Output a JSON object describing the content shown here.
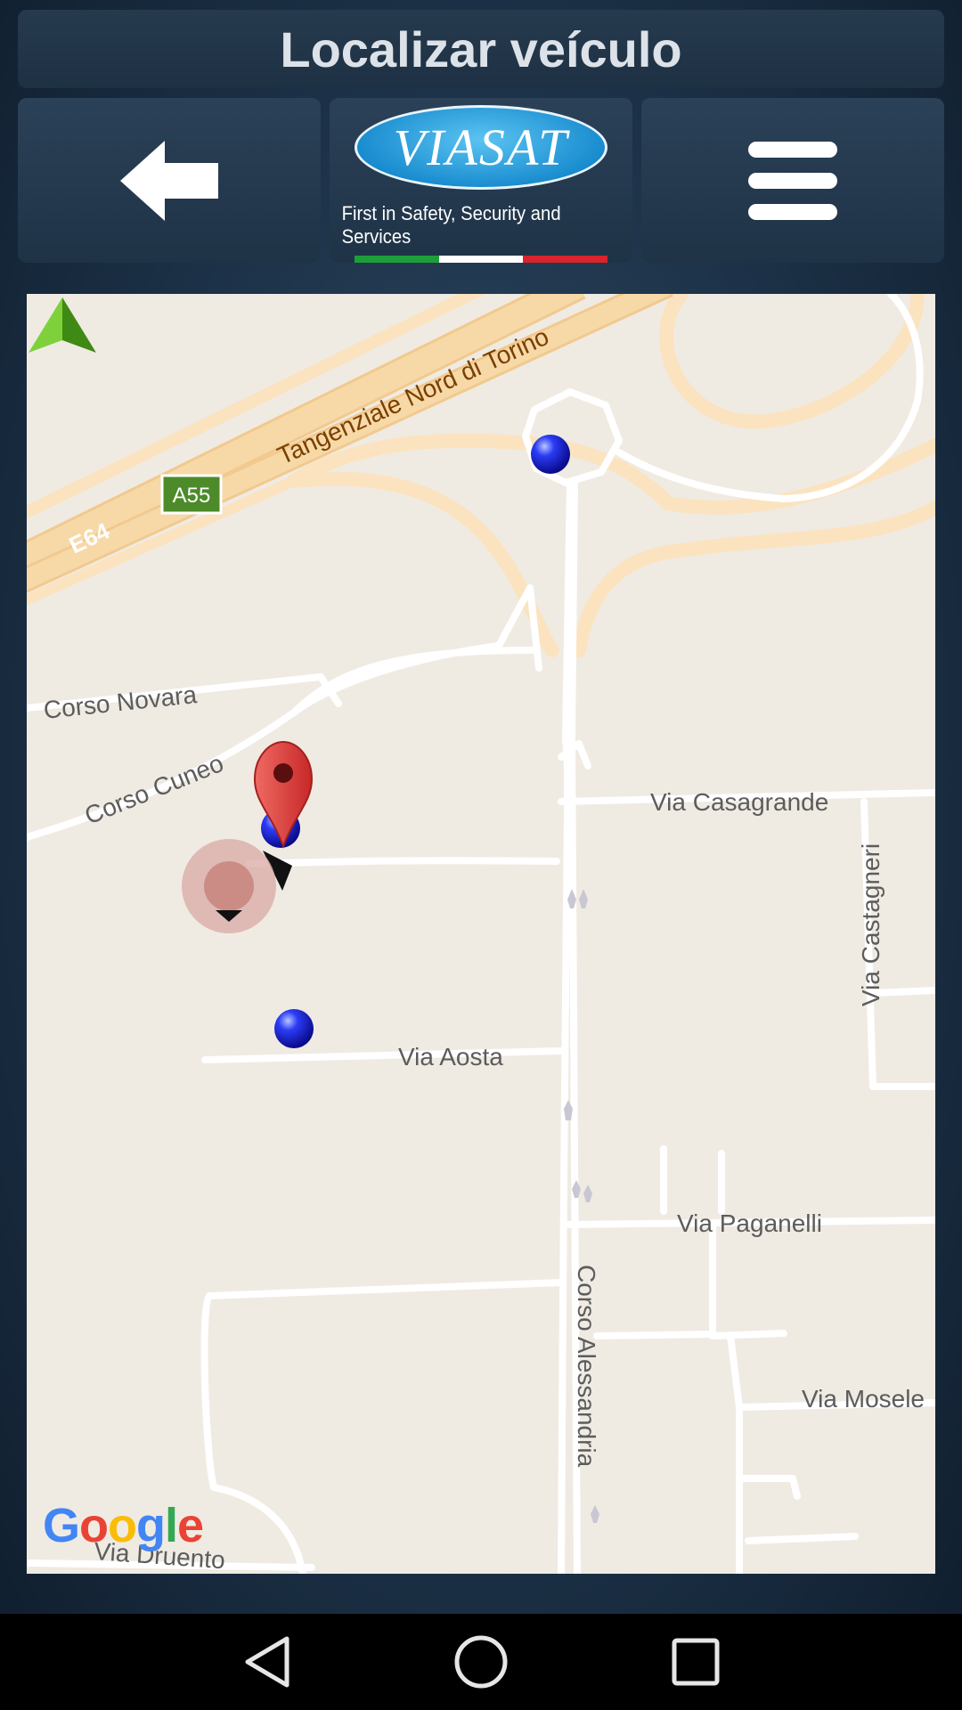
{
  "header": {
    "title": "Localizar veículo"
  },
  "toolbar": {
    "back_icon": "arrow-left-icon",
    "logo": {
      "brand": "VIASAT",
      "tagline": "First in Safety, Security and Services"
    },
    "menu_icon": "hamburger-menu-icon"
  },
  "map": {
    "roads": {
      "highway_name": "Tangenziale Nord di Torino",
      "route_e": "E64",
      "route_a": "A55",
      "streets": [
        "Corso Novara",
        "Corso Cuneo",
        "Via Casagrande",
        "Via Castagneri",
        "Via Aosta",
        "Via Paganelli",
        "Corso Alessandria",
        "Via Mosele",
        "Via Druento"
      ]
    },
    "markers": {
      "vehicle_pin": "map-pin-icon",
      "positions": [
        "blue-dot-icon",
        "blue-dot-icon",
        "blue-dot-icon"
      ],
      "my_location": "my-location-icon",
      "compass": "compass-arrow-icon"
    },
    "attribution": "Google"
  },
  "system_nav": {
    "back": "nav-back-icon",
    "home": "nav-home-icon",
    "recents": "nav-recents-icon"
  },
  "colors": {
    "background": "#1c3147",
    "map_bg": "#efebe3",
    "highway": "#f7d9a8",
    "pin": "#e53935",
    "dot": "#1a1aff"
  }
}
